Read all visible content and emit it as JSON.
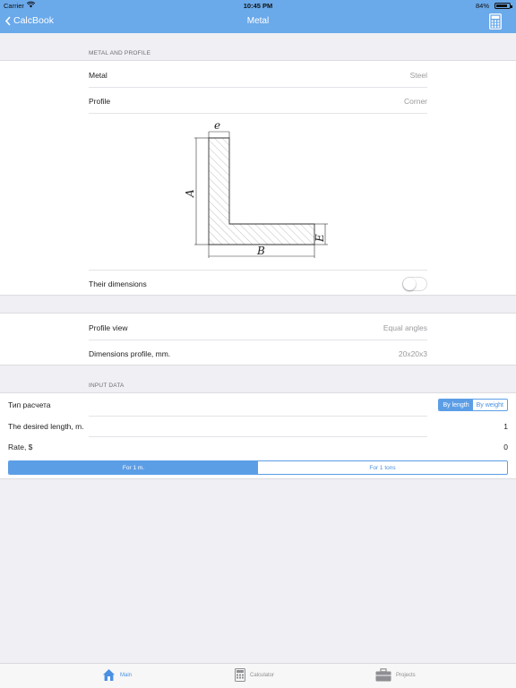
{
  "status_bar": {
    "carrier": "Carrier",
    "time": "10:45 PM",
    "battery": "84%",
    "battery_level": 0.84
  },
  "nav": {
    "back_label": "CalcBook",
    "title": "Metal"
  },
  "metal_section": {
    "header": "METAL AND PROFILE",
    "metal_label": "Metal",
    "metal_value": "Steel",
    "profile_label": "Profile",
    "profile_value": "Corner",
    "diagram_labels": {
      "a": "A",
      "b": "B",
      "e": "e",
      "E": "E"
    },
    "dimensions_label": "Their dimensions",
    "dimensions_toggle_on": false
  },
  "profile_section": {
    "view_label": "Profile view",
    "view_value": "Equal angles",
    "dims_label": "Dimensions profile, mm.",
    "dims_value": "20x20x3"
  },
  "input_section": {
    "header": "INPUT DATA",
    "calc_type_label": "Тип расчета",
    "calc_type_options": [
      "By length",
      "By weight"
    ],
    "calc_type_selected": "By length",
    "length_label": "The desired length, m.",
    "length_value": "1",
    "rate_label": "Rate, $",
    "rate_value": "0",
    "unit_options": [
      "For 1 m.",
      "For 1 tons"
    ],
    "unit_selected": "For 1 m."
  },
  "tabs": [
    {
      "label": "Main",
      "icon": "home-icon",
      "active": true
    },
    {
      "label": "Calculator",
      "icon": "calculator-icon",
      "active": false
    },
    {
      "label": "Projects",
      "icon": "briefcase-icon",
      "active": false
    }
  ],
  "colors": {
    "accent": "#6aa9ea",
    "segment": "#5c9ee6",
    "background": "#efeff4"
  }
}
